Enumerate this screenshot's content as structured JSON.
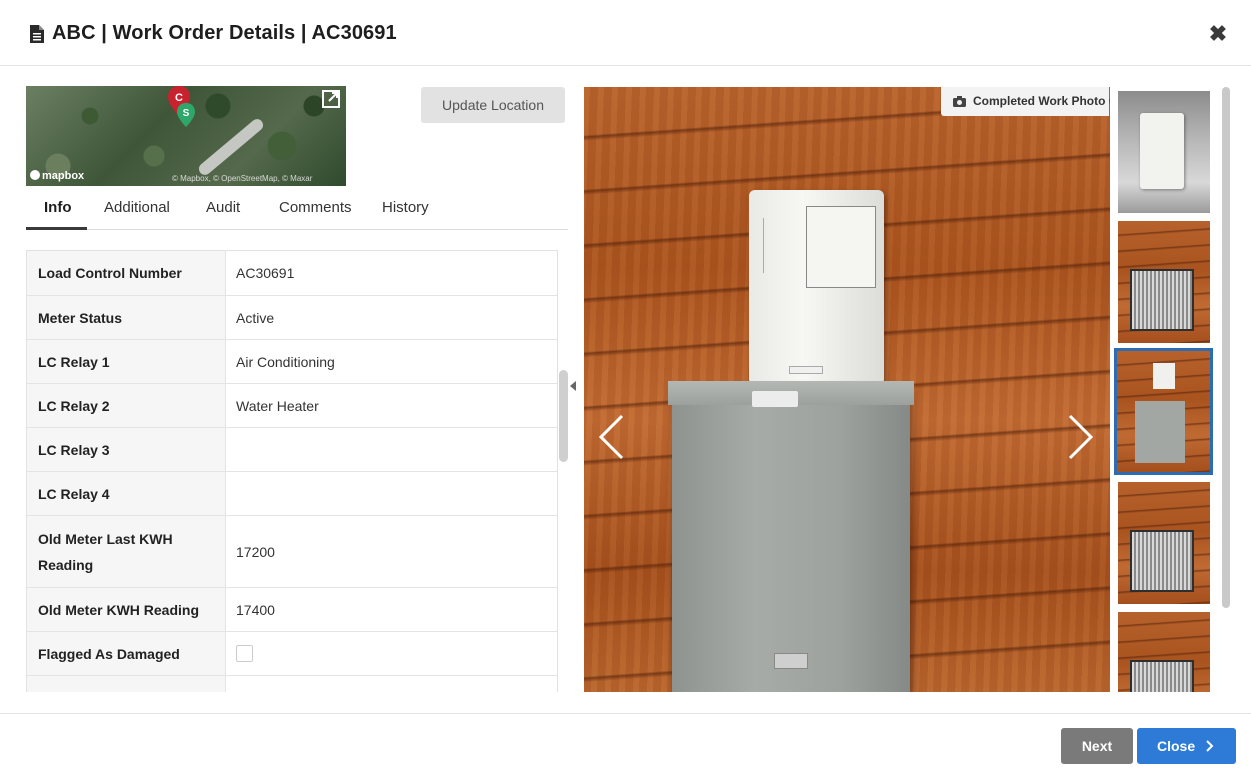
{
  "header": {
    "title": "ABC | Work Order Details | AC30691",
    "close_icon": "close-icon"
  },
  "map": {
    "pin_c_label": "C",
    "pin_s_label": "S",
    "logo_text": "mapbox",
    "attribution": "© Mapbox, © OpenStreetMap, © Maxar",
    "update_location_label": "Update Location"
  },
  "tabs": [
    {
      "label": "Info",
      "active": true
    },
    {
      "label": "Additional",
      "active": false
    },
    {
      "label": "Audit",
      "active": false
    },
    {
      "label": "Comments",
      "active": false
    },
    {
      "label": "History",
      "active": false
    }
  ],
  "details": [
    {
      "label": "Load Control Number",
      "value": "AC30691"
    },
    {
      "label": "Meter Status",
      "value": "Active"
    },
    {
      "label": "LC Relay 1",
      "value": "Air Conditioning"
    },
    {
      "label": "LC Relay 2",
      "value": "Water Heater"
    },
    {
      "label": "LC Relay 3",
      "value": ""
    },
    {
      "label": "LC Relay 4",
      "value": ""
    },
    {
      "label": "Old Meter Last KWH Reading",
      "value": "17200"
    },
    {
      "label": "Old Meter KWH Reading",
      "value": "17400"
    },
    {
      "label": "Flagged As Damaged",
      "value": "",
      "checked": false
    }
  ],
  "photo": {
    "tag_label": "Completed Work Photo",
    "thumbnail_count": 5,
    "selected_thumbnail": 3
  },
  "footer": {
    "next_label": "Next",
    "close_label": "Close"
  },
  "colors": {
    "primary": "#2d7bd6",
    "secondary_button": "#7a7a7a",
    "selected_thumb_border": "#2c6cb3"
  }
}
